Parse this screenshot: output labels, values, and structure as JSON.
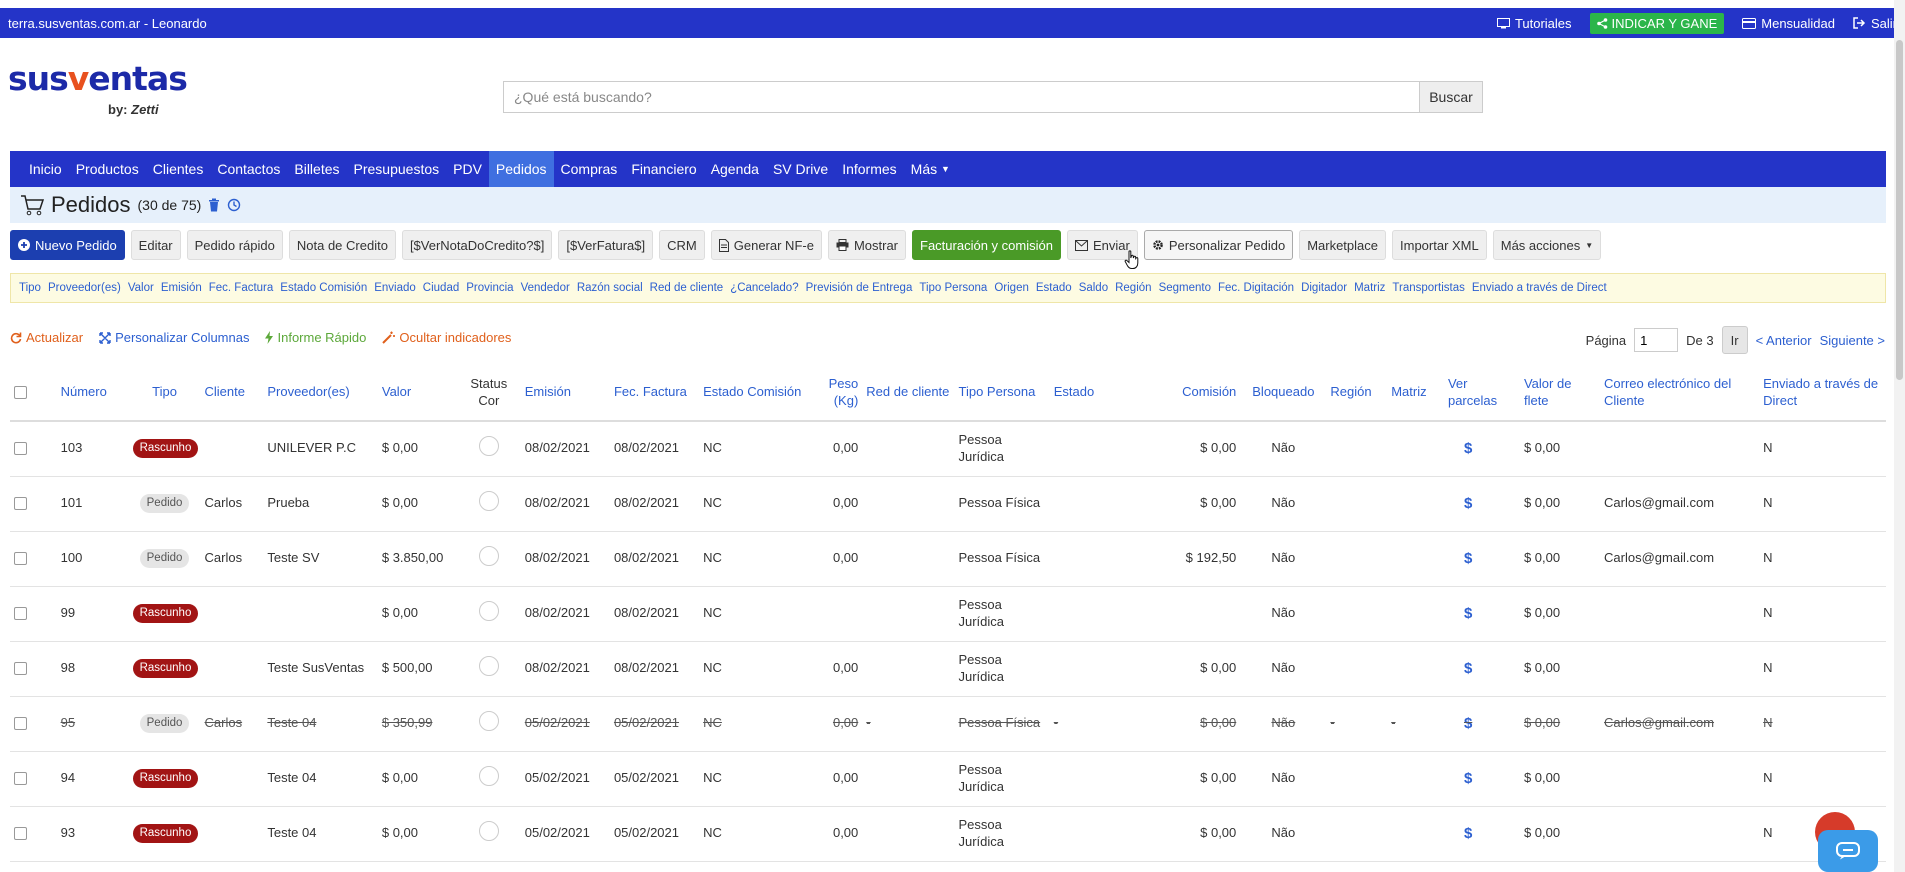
{
  "topbar": {
    "site": "terra.susventas.com.ar - Leonardo",
    "links": [
      {
        "label": "Tutoriales",
        "icon": "monitor-icon"
      },
      {
        "label": "INDICAR Y GANE",
        "icon": "share-icon"
      },
      {
        "label": "Mensualidad",
        "icon": "card-icon"
      },
      {
        "label": "Salir",
        "icon": "logout-icon"
      }
    ]
  },
  "logo": {
    "word_a": "sus",
    "word_v": "v",
    "word_b": "entas",
    "by": "by:",
    "brand": "Zetti"
  },
  "search": {
    "placeholder": "¿Qué está buscando?",
    "button": "Buscar"
  },
  "nav": [
    {
      "label": "Inicio"
    },
    {
      "label": "Productos"
    },
    {
      "label": "Clientes"
    },
    {
      "label": "Contactos"
    },
    {
      "label": "Billetes"
    },
    {
      "label": "Presupuestos"
    },
    {
      "label": "PDV"
    },
    {
      "label": "Pedidos"
    },
    {
      "label": "Compras"
    },
    {
      "label": "Financiero"
    },
    {
      "label": "Agenda"
    },
    {
      "label": "SV Drive"
    },
    {
      "label": "Informes"
    },
    {
      "label": "Más"
    }
  ],
  "nav_active": "Pedidos",
  "page": {
    "title": "Pedidos",
    "count": "(30 de 75)"
  },
  "toolbar": {
    "nuevo": "Nuevo Pedido",
    "editar": "Editar",
    "rapido": "Pedido rápido",
    "nota": "Nota de Credito",
    "vernota": "[$VerNotaDoCredito?$]",
    "verfatura": "[$VerFatura$]",
    "crm": "CRM",
    "nfe": "Generar NF-e",
    "mostrar": "Mostrar",
    "facturacion": "Facturación y comisión",
    "enviar": "Enviar",
    "personalizar": "Personalizar Pedido",
    "marketplace": "Marketplace",
    "importar": "Importar XML",
    "mas": "Más acciones"
  },
  "filters": [
    "Tipo",
    "Proveedor(es)",
    "Valor",
    "Emisión",
    "Fec. Factura",
    "Estado Comisión",
    "Enviado",
    "Ciudad",
    "Provincia",
    "Vendedor",
    "Razón social",
    "Red de cliente",
    "¿Cancelado?",
    "Previsión de Entrega",
    "Tipo Persona",
    "Origen",
    "Estado",
    "Saldo",
    "Región",
    "Segmento",
    "Fec. Digitación",
    "Digitador",
    "Matriz",
    "Transportistas",
    "Enviado a través de Direct"
  ],
  "actions": {
    "actualizar": "Actualizar",
    "columnas": "Personalizar Columnas",
    "informe": "Informe Rápido",
    "ocultar": "Ocultar indicadores"
  },
  "pager": {
    "label": "Página",
    "page": "1",
    "of": "De 3",
    "go": "Ir",
    "prev": "< Anterior",
    "next": "Siguiente >"
  },
  "table": {
    "headers": {
      "numero": "Número",
      "tipo": "Tipo",
      "cliente": "Cliente",
      "proveedor": "Proveedor(es)",
      "valor": "Valor",
      "status": "Status Cor",
      "emision": "Emisión",
      "fec_factura": "Fec. Factura",
      "estado_comision": "Estado Comisión",
      "peso": "Peso (Kg)",
      "red": "Red de cliente",
      "tipo_persona": "Tipo Persona",
      "estado": "Estado",
      "comision": "Comisión",
      "bloqueado": "Bloqueado",
      "region": "Región",
      "matriz": "Matriz",
      "parcelas": "Ver parcelas",
      "flete": "Valor de flete",
      "correo": "Correo electrónico del Cliente",
      "direct": "Enviado a través de Direct"
    },
    "rows": [
      {
        "numero": "103",
        "tipo": "Rascunho",
        "cliente": "",
        "proveedor": "UNILEVER P.C",
        "valor": "$ 0,00",
        "emision": "08/02/2021",
        "fec_factura": "08/02/2021",
        "estado_comision": "NC",
        "peso": "0,00",
        "red": "",
        "tipo_persona": "Pessoa Jurídica",
        "estado": "",
        "comision": "$ 0,00",
        "bloqueado": "Não",
        "region": "",
        "matriz": "",
        "parcelas": "$",
        "flete": "$ 0,00",
        "correo": "",
        "direct": "N"
      },
      {
        "numero": "101",
        "tipo": "Pedido",
        "cliente": "Carlos",
        "proveedor": "Prueba",
        "valor": "$ 0,00",
        "emision": "08/02/2021",
        "fec_factura": "08/02/2021",
        "estado_comision": "NC",
        "peso": "0,00",
        "red": "",
        "tipo_persona": "Pessoa Física",
        "estado": "",
        "comision": "$ 0,00",
        "bloqueado": "Não",
        "region": "",
        "matriz": "",
        "parcelas": "$",
        "flete": "$ 0,00",
        "correo": "Carlos@gmail.com",
        "direct": "N"
      },
      {
        "numero": "100",
        "tipo": "Pedido",
        "cliente": "Carlos",
        "proveedor": "Teste SV",
        "valor": "$ 3.850,00",
        "emision": "08/02/2021",
        "fec_factura": "08/02/2021",
        "estado_comision": "NC",
        "peso": "0,00",
        "red": "",
        "tipo_persona": "Pessoa Física",
        "estado": "",
        "comision": "$ 192,50",
        "bloqueado": "Não",
        "region": "",
        "matriz": "",
        "parcelas": "$",
        "flete": "$ 0,00",
        "correo": "Carlos@gmail.com",
        "direct": "N"
      },
      {
        "numero": "99",
        "tipo": "Rascunho",
        "cliente": "",
        "proveedor": "",
        "valor": "$ 0,00",
        "emision": "08/02/2021",
        "fec_factura": "08/02/2021",
        "estado_comision": "NC",
        "peso": "",
        "red": "",
        "tipo_persona": "Pessoa Jurídica",
        "estado": "",
        "comision": "",
        "bloqueado": "Não",
        "region": "",
        "matriz": "",
        "parcelas": "$",
        "flete": "$ 0,00",
        "correo": "",
        "direct": "N"
      },
      {
        "numero": "98",
        "tipo": "Rascunho",
        "cliente": "",
        "proveedor": "Teste SusVentas",
        "valor": "$ 500,00",
        "emision": "08/02/2021",
        "fec_factura": "08/02/2021",
        "estado_comision": "NC",
        "peso": "0,00",
        "red": "",
        "tipo_persona": "Pessoa Jurídica",
        "estado": "",
        "comision": "$ 0,00",
        "bloqueado": "Não",
        "region": "",
        "matriz": "",
        "parcelas": "$",
        "flete": "$ 0,00",
        "correo": "",
        "direct": "N"
      },
      {
        "numero": "95",
        "tipo": "Pedido",
        "cliente": "Carlos",
        "proveedor": "Teste 04",
        "valor": "$ 350,99",
        "emision": "05/02/2021",
        "fec_factura": "05/02/2021",
        "estado_comision": "NC",
        "peso": "0,00",
        "red": "-",
        "tipo_persona": "Pessoa Física",
        "estado": "-",
        "comision": "$ 0,00",
        "bloqueado": "Não",
        "region": "-",
        "matriz": "-",
        "parcelas": "$",
        "flete": "$ 0,00",
        "correo": "Carlos@gmail.com",
        "direct": "N",
        "cancelled": true
      },
      {
        "numero": "94",
        "tipo": "Rascunho",
        "cliente": "",
        "proveedor": "Teste 04",
        "valor": "$ 0,00",
        "emision": "05/02/2021",
        "fec_factura": "05/02/2021",
        "estado_comision": "NC",
        "peso": "0,00",
        "red": "",
        "tipo_persona": "Pessoa Jurídica",
        "estado": "",
        "comision": "$ 0,00",
        "bloqueado": "Não",
        "region": "",
        "matriz": "",
        "parcelas": "$",
        "flete": "$ 0,00",
        "correo": "",
        "direct": "N"
      },
      {
        "numero": "93",
        "tipo": "Rascunho",
        "cliente": "",
        "proveedor": "Teste 04",
        "valor": "$ 0,00",
        "emision": "05/02/2021",
        "fec_factura": "05/02/2021",
        "estado_comision": "NC",
        "peso": "0,00",
        "red": "",
        "tipo_persona": "Pessoa Jurídica",
        "estado": "",
        "comision": "$ 0,00",
        "bloqueado": "Não",
        "region": "",
        "matriz": "",
        "parcelas": "$",
        "flete": "$ 0,00",
        "correo": "",
        "direct": "N"
      }
    ]
  },
  "colors": {
    "topbar": "#2434c8",
    "nav_active": "#3f6fe0",
    "rascunho": "#a21414",
    "link": "#2c5fd0",
    "green": "#4a9a27"
  }
}
